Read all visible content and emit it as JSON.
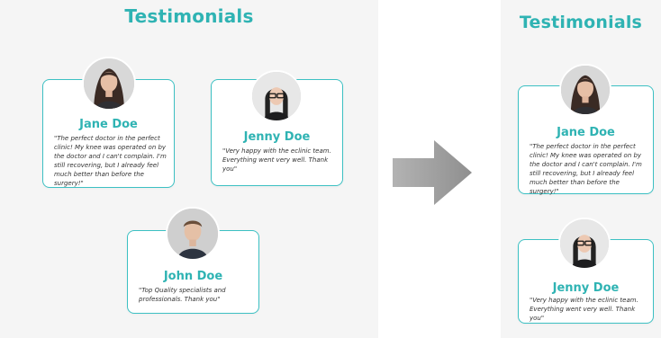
{
  "desktop": {
    "title": "Testimonials",
    "testimonials": [
      {
        "name": "Jane Doe",
        "quote": "\"The perfect doctor in the perfect clinic! My knee was operated on by the doctor and I can't complain. I'm still recovering, but I already feel much better than before the surgery!\"",
        "avatar_icon": "woman-portrait-icon"
      },
      {
        "name": "Jenny Doe",
        "quote": "\"Very happy with the eclinic team. Everything went very well. Thank you\"",
        "avatar_icon": "woman-glasses-portrait-icon"
      },
      {
        "name": "John Doe",
        "quote": "\"Top Quality specialists and professionals. Thank you\"",
        "avatar_icon": "man-portrait-icon"
      }
    ]
  },
  "mobile": {
    "title": "Testimonials",
    "testimonials": [
      {
        "name": "Jane Doe",
        "quote": "\"The perfect doctor in the perfect clinic! My knee was operated on by the doctor and I can't complain. I'm still recovering, but I already feel much better than before the surgery!\"",
        "avatar_icon": "woman-portrait-icon"
      },
      {
        "name": "Jenny Doe",
        "quote": "\"Very happy with the eclinic team. Everything went very well. Thank you\"",
        "avatar_icon": "woman-glasses-portrait-icon"
      }
    ]
  },
  "colors": {
    "accent": "#2fb3b3",
    "card_border": "#3cc0c3",
    "panel_background": "#f5f5f5",
    "arrow": "#9a9a9a"
  }
}
